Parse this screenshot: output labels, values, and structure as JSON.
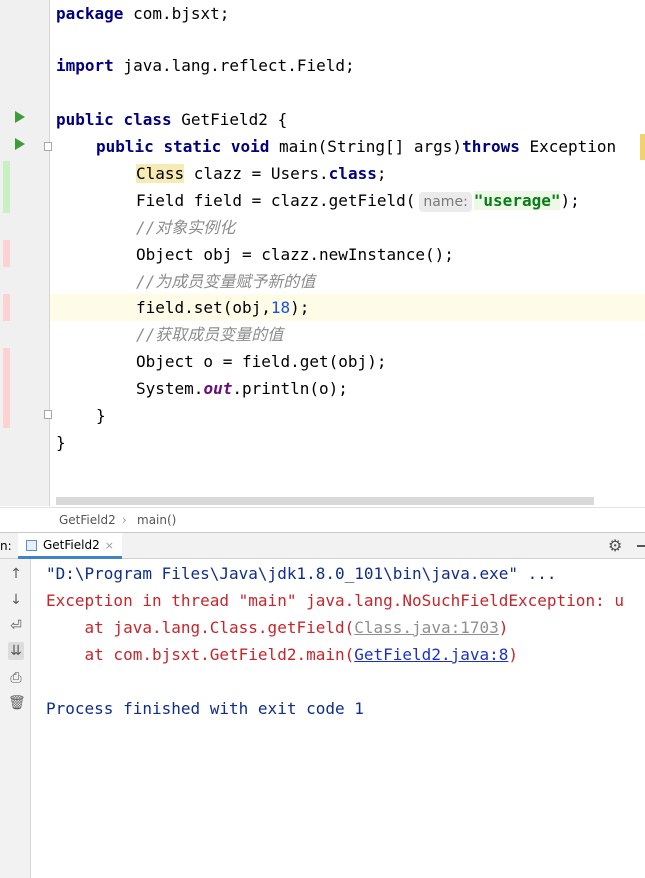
{
  "editor": {
    "line1": {
      "kw": "package",
      "rest": " com.bjsxt;"
    },
    "line2": {
      "kw": "import",
      "rest": " java.lang.reflect.Field;"
    },
    "line3": {
      "kw1": "public",
      "kw2": "class",
      "rest": " GetField2 {"
    },
    "line4": {
      "kw1": "public",
      "kw2": "static",
      "kw3": "void",
      "mid": " main(String[] args)",
      "kw4": "throws",
      "rest": " Exception"
    },
    "line5": {
      "class_kw": "Class",
      "mid": " clazz = Users.",
      "kw": "class",
      "end": ";"
    },
    "line6": {
      "pre": "Field field = clazz.getField(",
      "hint": "name:",
      "str": "\"userage\"",
      "end": ");"
    },
    "line7": {
      "comment": "//对象实例化"
    },
    "line8": {
      "text": "Object obj = clazz.newInstance();"
    },
    "line9": {
      "comment": "//为成员变量赋予新的值"
    },
    "line10": {
      "pre": "field.set(obj,",
      "num": "18",
      "end": ");"
    },
    "line11": {
      "comment": "//获取成员变量的值"
    },
    "line12": {
      "text": "Object o = field.get(obj);"
    },
    "line13": {
      "pre": "System.",
      "field": "out",
      "end": ".println(o);"
    },
    "line14": {
      "text": "}"
    },
    "line15": {
      "text": "}"
    }
  },
  "breadcrumb": {
    "class": "GetField2",
    "separator": "›",
    "method": "main()"
  },
  "run_panel": {
    "label_cut": "n:",
    "tab_label": "GetField2",
    "tab_close": "×",
    "console": {
      "cmd": "\"D:\\Program Files\\Java\\jdk1.8.0_101\\bin\\java.exe\" ...",
      "exception": "Exception in thread \"main\" java.lang.NoSuchFieldException: u",
      "trace1_pre": "    at java.lang.Class.getField(",
      "trace1_link": "Class.java:1703",
      "trace1_end": ")",
      "trace2_pre": "    at com.bjsxt.GetField2.main(",
      "trace2_link": "GetField2.java:8",
      "trace2_end": ")",
      "exit": "Process finished with exit code 1"
    },
    "toolbar_icons": [
      "up-arrow-icon",
      "down-arrow-icon",
      "soft-wrap-icon",
      "scroll-to-end-icon",
      "print-icon",
      "trash-icon"
    ],
    "toolbar_glyphs": [
      "↑",
      "↓",
      "⏎",
      "⇊",
      "⎙",
      "🗑"
    ]
  },
  "colors": {
    "keyword": "#000080",
    "string": "#067d17",
    "number": "#1750eb",
    "comment": "#8c8c8c",
    "error": "#c7252c",
    "run_green": "#3f9c38"
  }
}
